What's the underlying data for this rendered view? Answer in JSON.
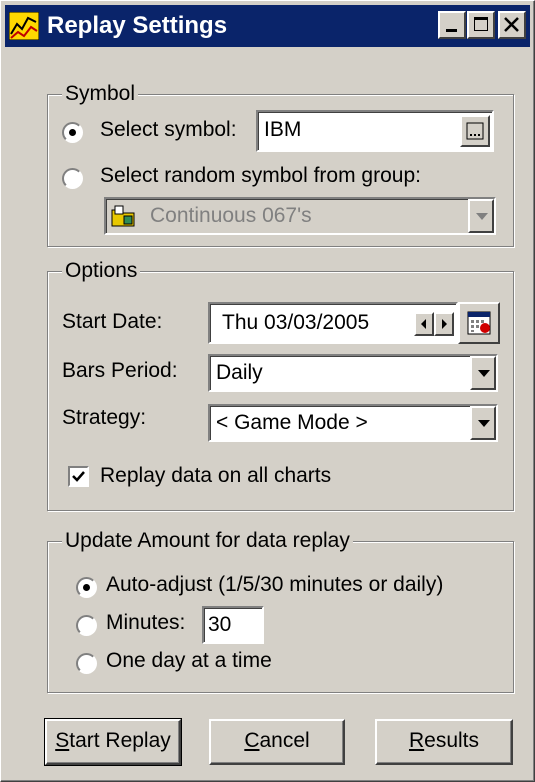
{
  "window": {
    "title": "Replay Settings",
    "controls": {
      "minimize": "minimize",
      "maximize": "maximize",
      "close": "close"
    }
  },
  "symbol": {
    "group_title": "Symbol",
    "select_symbol_label": "Select symbol:",
    "select_symbol_checked": true,
    "symbol_value": "IBM",
    "random_label": "Select random symbol from group:",
    "random_checked": false,
    "group_value": "Continuous 067's"
  },
  "options": {
    "group_title": "Options",
    "start_date_label": "Start Date:",
    "start_date_value": "Thu  03/03/2005",
    "bars_period_label": "Bars Period:",
    "bars_period_value": "Daily",
    "strategy_label": "Strategy:",
    "strategy_value": "< Game Mode >",
    "replay_all_label": "Replay data on all charts",
    "replay_all_checked": true
  },
  "update": {
    "group_title": "Update Amount for data replay",
    "auto_label": "Auto-adjust (1/5/30 minutes or daily)",
    "auto_checked": true,
    "minutes_label": "Minutes:",
    "minutes_value": "30",
    "one_day_label": "One day at a time"
  },
  "buttons": {
    "start_rest": "tart Replay",
    "start_key": "S",
    "cancel_rest": "ancel",
    "cancel_key": "C",
    "results_rest": "esults",
    "results_key": "R"
  },
  "colors": {
    "face": "#d4d0c8",
    "titlebar": "#0a246a",
    "shadow": "#808080",
    "highlight": "#ffffff"
  }
}
